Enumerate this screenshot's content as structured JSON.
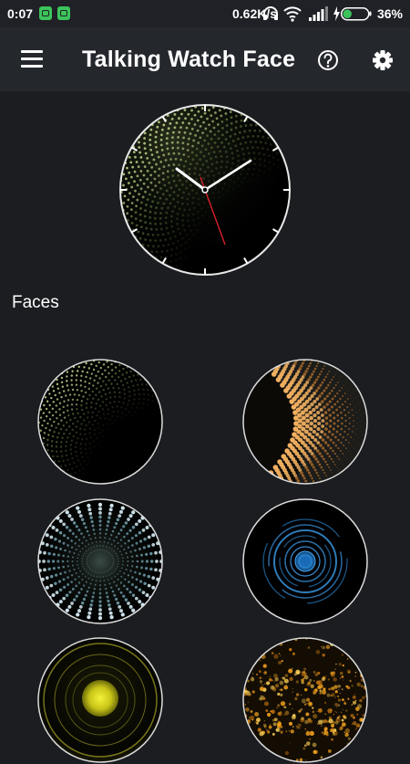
{
  "status_bar": {
    "time": "0:07",
    "network_speed": "0.62K/s",
    "battery_percent": "36%",
    "notification_icons": [
      "sim-icon",
      "android-icon"
    ],
    "system_icons": [
      "headset-icon",
      "wifi-icon",
      "signal-icon",
      "charging-icon",
      "battery-icon"
    ],
    "battery_level": 0.36
  },
  "app_bar": {
    "title": "Talking Watch Face",
    "icons": [
      "menu-icon",
      "help-icon",
      "settings-icon"
    ]
  },
  "preview": {
    "icon": "watch-face-preview"
  },
  "faces_section": {
    "title": "Faces",
    "items": [
      {
        "icon": "green-dots-face"
      },
      {
        "icon": "orange-wave-face"
      },
      {
        "icon": "blue-dot-tunnel-face"
      },
      {
        "icon": "blue-rings-face"
      },
      {
        "icon": "yellow-glow-face"
      },
      {
        "icon": "gold-bokeh-face"
      }
    ]
  },
  "colors": {
    "background": "#1b1d21",
    "app_bar": "#24272c",
    "status_bar": "#1f2126",
    "text": "#ffffff",
    "second_hand": "#d8202a",
    "battery_green": "#3cc35b"
  }
}
